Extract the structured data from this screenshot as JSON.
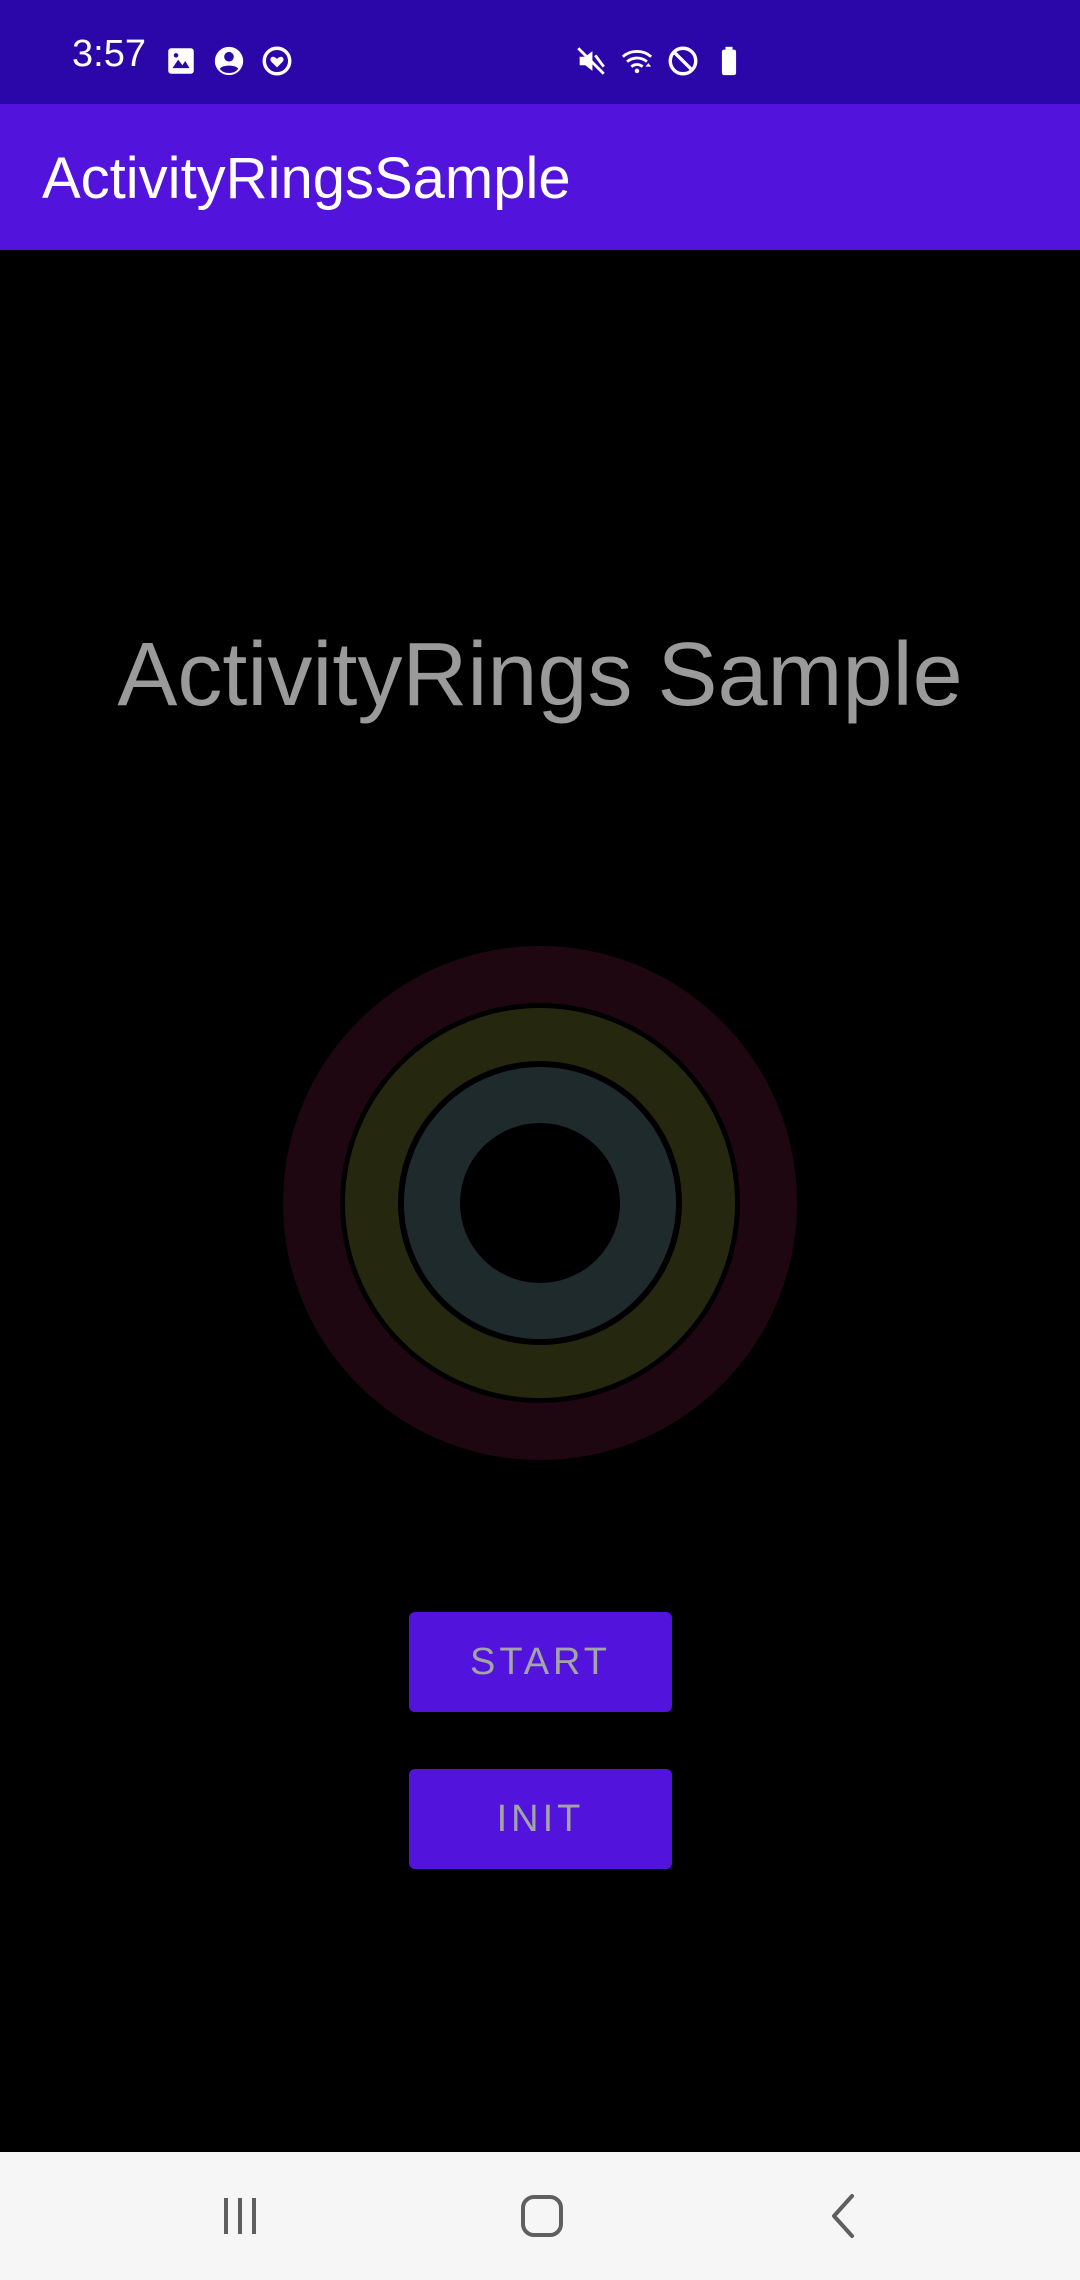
{
  "status_bar": {
    "time": "3:57",
    "left_icons": [
      "gallery-icon",
      "account-icon",
      "heart-shield-icon"
    ],
    "right_icons": [
      "mute-icon",
      "wifi-icon",
      "do-not-disturb-icon",
      "battery-icon"
    ],
    "background": "#2b06a8"
  },
  "app_bar": {
    "title": "ActivityRingsSample",
    "background": "#5214dc"
  },
  "main": {
    "heading": "ActivityRings Sample",
    "rings": {
      "outer_color": "#1e0710",
      "middle_color": "#25280f",
      "inner_color": "#1f2a2c"
    },
    "start_label": "START",
    "init_label": "INIT",
    "button_color": "#5214dc"
  },
  "nav_bar": {
    "buttons": [
      "recents-icon",
      "home-icon",
      "back-icon"
    ]
  }
}
